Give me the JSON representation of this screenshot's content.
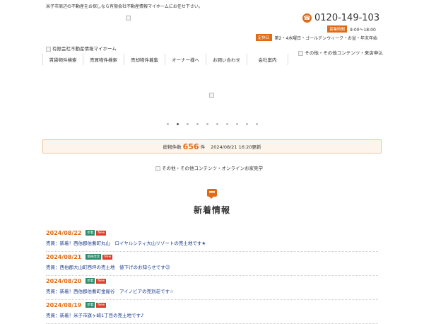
{
  "header": {
    "tagline": "米子市周辺の不動産をお探しなら有限会社不動産情報マイホームにお任せ下さい。",
    "phone": "0120-149-103",
    "hours_label": "営業時間",
    "hours": "9:00～18:00",
    "closed_label": "定休日",
    "closed_days": "第2・4水曜日・ゴールデンウィーク・お盆・年末年始",
    "logo_alt": "有限会社不動産情報マイホーム",
    "other_contents": "その他・その他コンテンツ・来店申込"
  },
  "nav": {
    "items": [
      {
        "label": "賃貸物件検索"
      },
      {
        "label": "売買物件検索"
      },
      {
        "label": "売却物件募集"
      },
      {
        "label": "オーナー様へ"
      },
      {
        "label": "お問い合わせ"
      },
      {
        "label": "会社案内"
      }
    ]
  },
  "slider": {
    "dot_count": 10,
    "active_index": 1
  },
  "stats": {
    "label": "総物件数",
    "count": "656",
    "unit": "件",
    "updated": "2024/08/21 16:20更新"
  },
  "banner": {
    "alt": "その他・その他コンテンツ・オンラインお家見学"
  },
  "news": {
    "title": "新着情報",
    "items": [
      {
        "date": "2024/08/22",
        "tag1": "新着",
        "tag2": "New",
        "text": "売買：新着！西伯郡伯耆町丸山　ロイヤルシティ大山リゾートの売土地です★"
      },
      {
        "date": "2024/08/21",
        "tag1": "価格改定",
        "tag2": "New",
        "text": "売買：西伯郡大山町西坪の売土地　値下げのお知らせです☺"
      },
      {
        "date": "2024/08/20",
        "tag1": "新着",
        "tag2": "New",
        "text": "売買：新着！西伯郡伯耆町金屋谷　アイノビアの売別荘です☆"
      },
      {
        "date": "2024/08/19",
        "tag1": "新着",
        "tag2": "New",
        "text": "売買：新着！米子市旗ヶ崎1丁目の売土地です♪"
      }
    ]
  },
  "colors": {
    "accent": "#e06b17",
    "link": "#1a3a8f",
    "tag_green": "#2e8b6a",
    "tag_red": "#e03c2a"
  }
}
